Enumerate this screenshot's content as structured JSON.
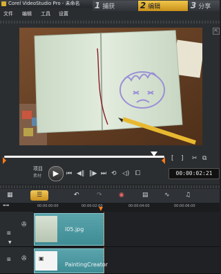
{
  "window": {
    "title": "Corel VideoStudio Pro - 未命名"
  },
  "menu": {
    "items": [
      "文件",
      "编辑",
      "工具",
      "设置"
    ]
  },
  "steps": [
    {
      "num": "1",
      "label": "捕获"
    },
    {
      "num": "2",
      "label": "编辑"
    },
    {
      "num": "3",
      "label": "分享"
    }
  ],
  "preview": {
    "mode_project": "项目",
    "mode_clip": "素材",
    "timecode": "00:00:02:21"
  },
  "timeline": {
    "ruler_ticks": [
      "00:00:00:00",
      "00:00:02:00",
      "00:00:04:00",
      "00:00:06:00"
    ],
    "clips": [
      {
        "name": "l05.jpg"
      },
      {
        "name": "PaintingCreator"
      }
    ]
  },
  "colors": {
    "accent": "#e8a824",
    "clip": "#4a97a0",
    "playhead": "#ff7a1a"
  }
}
